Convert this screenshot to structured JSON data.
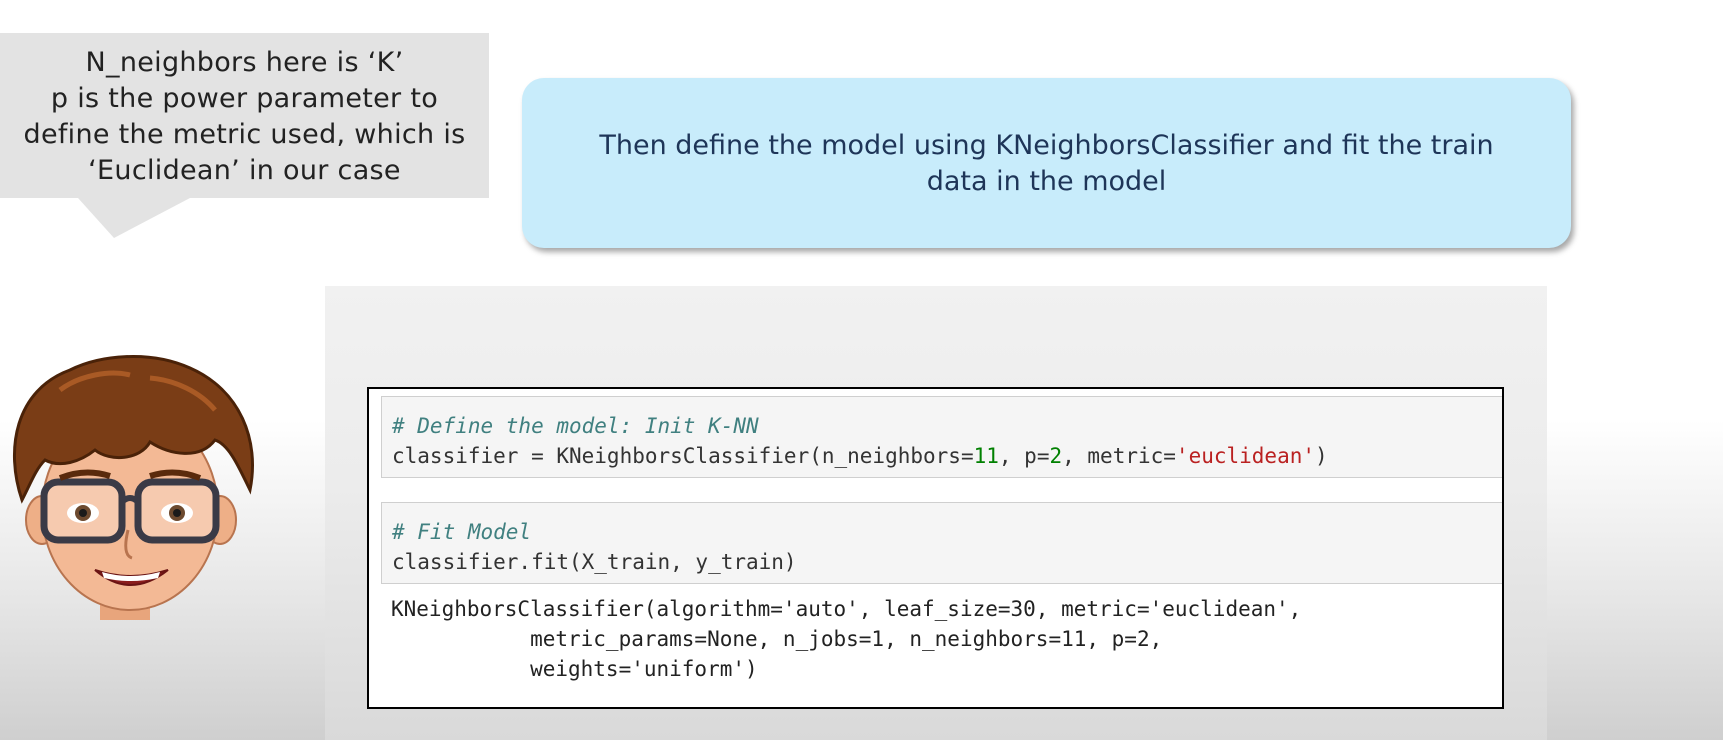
{
  "callout": {
    "lines": [
      "N_neighbors here is ‘K’",
      "p is the power parameter to",
      "define the metric used, which is",
      "‘Euclidean’ in our case"
    ]
  },
  "info_box": {
    "lines": [
      "Then define the model using KNeighborsClassifier and fit the train",
      "data in the model"
    ]
  },
  "notebook": {
    "cell1": {
      "comment": "# Define the model: Init K-NN",
      "code": {
        "prefix": "classifier = KNeighborsClassifier(n_neighbors=",
        "n_neighbors": "11",
        "mid1": ", p=",
        "p": "2",
        "mid2": ", metric=",
        "metric": "'euclidean'",
        "suffix": ")"
      }
    },
    "cell2": {
      "comment": "# Fit Model",
      "code": "classifier.fit(X_train, y_train)"
    },
    "output": {
      "lines": [
        "KNeighborsClassifier(algorithm='auto', leaf_size=30, metric='euclidean',",
        "           metric_params=None, n_jobs=1, n_neighbors=11, p=2,",
        "           weights='uniform')"
      ]
    }
  },
  "colors": {
    "callout_bg": "#e3e3e3",
    "info_box_bg": "#c8ecfb",
    "info_box_text": "#1e3558",
    "comment": "#408080",
    "number": "#008000",
    "string": "#ba2121"
  },
  "icons": {
    "avatar": "cartoon-boy-with-glasses-avatar"
  }
}
